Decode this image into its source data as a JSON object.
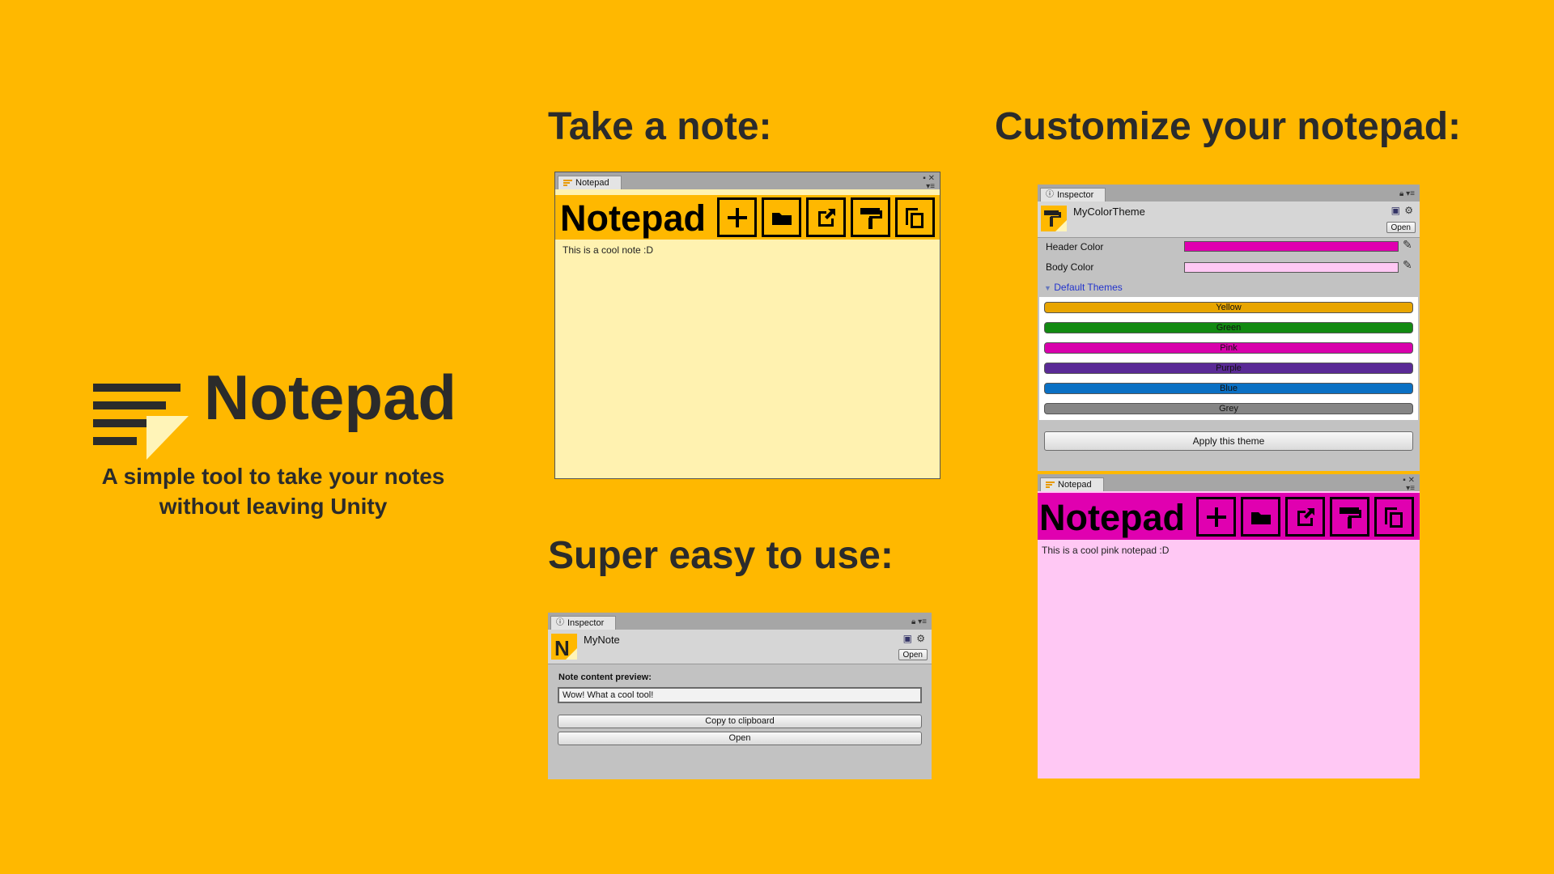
{
  "hero": {
    "title": "Notepad",
    "tagline_line1": "A simple tool to take your notes",
    "tagline_line2": "without leaving Unity"
  },
  "sections": {
    "take_note": "Take a note:",
    "easy": "Super easy to use:",
    "customize": "Customize your notepad:"
  },
  "notepad_yellow": {
    "tab": "Notepad",
    "title": "Notepad",
    "body_text": "This is a cool note :D",
    "header_color": "#FFB800",
    "body_color": "#FFF2B0",
    "buttons": [
      "plus-icon",
      "folder-icon",
      "external-link-icon",
      "paint-roller-icon",
      "copy-icon"
    ]
  },
  "note_inspector": {
    "tab": "Inspector",
    "asset_name": "MyNote",
    "open_label": "Open",
    "preview_label": "Note content preview:",
    "preview_value": "Wow! What a cool tool!",
    "copy_label": "Copy to clipboard",
    "open_button_label": "Open"
  },
  "theme_inspector": {
    "tab": "Inspector",
    "asset_name": "MyColorTheme",
    "open_label": "Open",
    "header_color_label": "Header Color",
    "body_color_label": "Body Color",
    "header_color": "#E000B0",
    "body_color": "#FFC8F4",
    "default_themes_label": "Default Themes",
    "themes": [
      {
        "label": "Yellow",
        "color": "#E8A500"
      },
      {
        "label": "Green",
        "color": "#128A12"
      },
      {
        "label": "Pink",
        "color": "#D800AC"
      },
      {
        "label": "Purple",
        "color": "#5A2A96"
      },
      {
        "label": "Blue",
        "color": "#0A70C4"
      },
      {
        "label": "Grey",
        "color": "#858585"
      }
    ],
    "apply_label": "Apply this theme"
  },
  "notepad_pink": {
    "tab": "Notepad",
    "title": "Notepad",
    "body_text": "This is a cool pink notepad :D",
    "header_color": "#E000B0",
    "body_color": "#FFC8F4"
  }
}
